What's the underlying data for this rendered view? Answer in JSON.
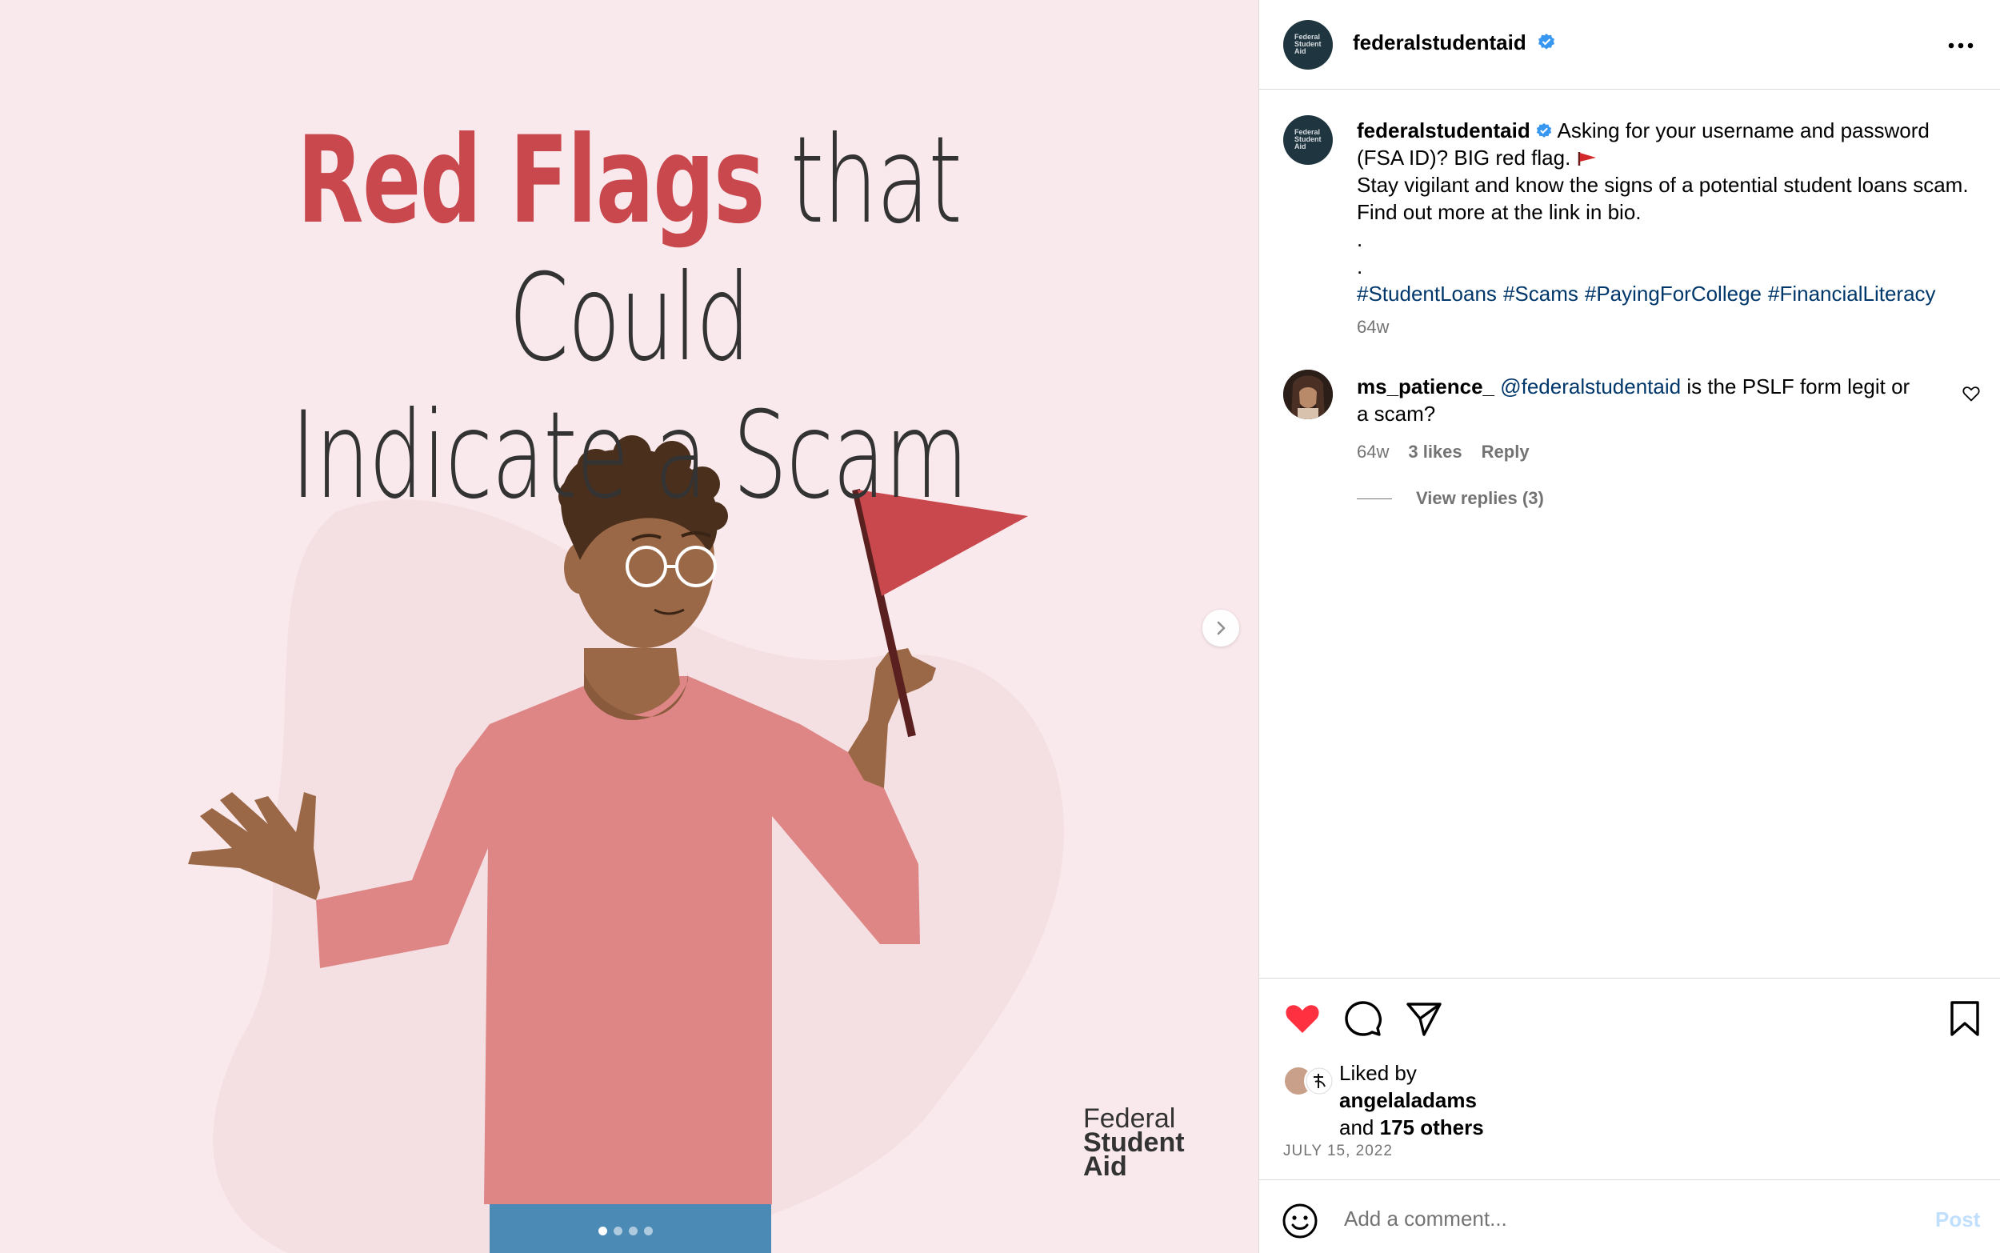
{
  "post": {
    "headline_red": "Red Flags",
    "headline_rest": "that Could",
    "headline_line2": "Indicate a Scam",
    "brand_logo": {
      "line1": "Federal",
      "line2": "Student",
      "line3": "Aid"
    },
    "carousel": {
      "count": 4,
      "active_index": 0
    },
    "colors": {
      "background": "#f9e9ec",
      "accent_red": "#c9484d",
      "shirt": "#de8585",
      "flag": "#c9484d"
    }
  },
  "header": {
    "username": "federalstudentaid",
    "avatar_text": [
      "Federal",
      "Student",
      "Aid"
    ],
    "verified_icon": "verified-badge-icon",
    "more_icon": "more-options-icon"
  },
  "caption": {
    "username": "federalstudentaid",
    "text_line1": "Asking for your username and password (FSA ID)? BIG red flag.",
    "text_line2": "Stay vigilant and know the signs of a potential student loans scam. Find out more at the link in bio.",
    "dot1": ".",
    "dot2": ".",
    "hashtags": [
      "#StudentLoans",
      "#Scams",
      "#PayingForCollege",
      "#FinancialLiteracy"
    ],
    "time": "64w"
  },
  "comment": {
    "username": "ms_patience_",
    "mention": "@federalstudentaid",
    "text": "is the PSLF form legit or a scam?",
    "time": "64w",
    "likes": "3 likes",
    "reply_label": "Reply",
    "view_replies": "View replies (3)"
  },
  "actions": {
    "like_icon": "heart-filled-icon",
    "comment_icon": "comment-icon",
    "share_icon": "share-icon",
    "save_icon": "bookmark-icon",
    "like_color": "#ff3040"
  },
  "likes": {
    "prefix": "Liked by",
    "user": "angelaladams",
    "and": "and",
    "others": "175 others"
  },
  "date": "JULY 15, 2022",
  "add_comment": {
    "placeholder": "Add a comment...",
    "post_label": "Post"
  }
}
